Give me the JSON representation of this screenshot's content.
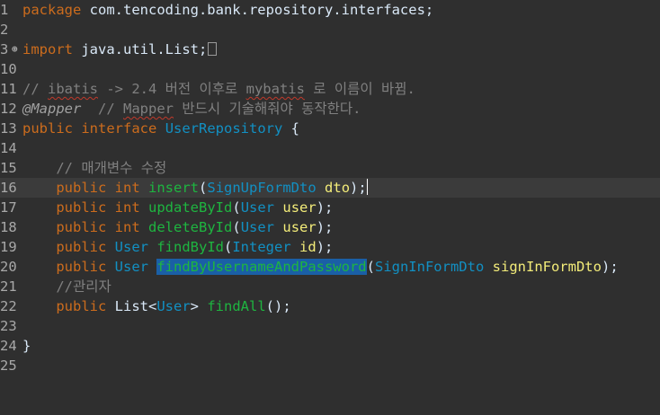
{
  "line_numbers": [
    "1",
    "2",
    "3",
    "10",
    "11",
    "12",
    "13",
    "14",
    "15",
    "16",
    "17",
    "18",
    "19",
    "20",
    "21",
    "22",
    "23",
    "24",
    "25"
  ],
  "code": {
    "package_kw": "package",
    "package_name": " com.tencoding.bank.repository.interfaces;",
    "import_kw": "import",
    "import_name": " java.util.List;",
    "comment1_prefix": "// ",
    "comment1_w1": "ibatis",
    "comment1_mid": " -> 2.4 버전 이후로 ",
    "comment1_w2": "mybatis",
    "comment1_end": " 로 이름이 바뀜.",
    "annotation": "@Mapper",
    "comment2_prefix": "  // ",
    "comment2_w": "Mapper",
    "comment2_end": " 반드시 기술해줘야 동작한다.",
    "public_kw": "public",
    "interface_kw": "interface",
    "interface_name": "UserRepository",
    "open_brace": " {",
    "comment3": "// 매개변수 수정",
    "int_kw": "int",
    "m_insert": "insert",
    "t_signup": "SignUpFormDto",
    "v_dto": "dto",
    "m_update": "updateById",
    "t_user": "User",
    "v_user": "user",
    "m_delete": "deleteById",
    "m_findById": "findById",
    "t_integer": "Integer",
    "v_id": "id",
    "m_findByUP": "findByUsernameAndPassword",
    "t_signin": "SignInFormDto",
    "v_signin": "signInFormDto",
    "comment4": "//관리자",
    "t_list": "List",
    "m_findAll": "findAll",
    "close_brace": "}"
  },
  "colors": {
    "background": "#2f2f2f",
    "keyword": "#cc6c1d",
    "type": "#1290c3",
    "method": "#1eb540",
    "comment": "#808080",
    "selection": "#1a5fa6"
  },
  "icons": {
    "fold_marker": "fold-expand-icon"
  }
}
